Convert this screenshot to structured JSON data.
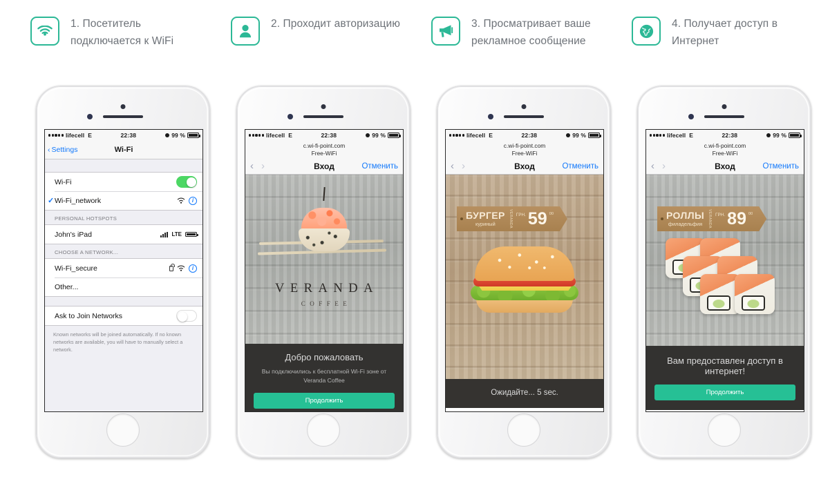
{
  "steps": [
    {
      "icon": "wifi-icon",
      "text": "1. Посетитель подключается к WiFi"
    },
    {
      "icon": "user-icon",
      "text": "2. Проходит авторизацию"
    },
    {
      "icon": "megaphone-icon",
      "text": "3. Просматривает ваше рекламное сообщение"
    },
    {
      "icon": "globe-icon",
      "text": "4. Получает доступ в Интернет"
    }
  ],
  "status_bar": {
    "carrier": "lifecell",
    "network": "E",
    "time": "22:38",
    "battery": "99 %"
  },
  "phone1": {
    "nav": {
      "back": "Settings",
      "title": "Wi-Fi"
    },
    "rows": {
      "wifi_label": "Wi-Fi",
      "wifi_toggle": "on",
      "connected_network": "Wi-Fi_network",
      "hotspots_header": "PERSONAL HOTSPOTS",
      "hotspot_name": "John's iPad",
      "hotspot_badge": "LTE",
      "choose_header": "CHOOSE A NETWORK...",
      "secure_network": "Wi-Fi_secure",
      "other": "Other...",
      "ask_label": "Ask to Join Networks",
      "ask_toggle": "off",
      "footnote": "Known networks will be joined automatically. If no known networks are available, you will have to manually select a network."
    }
  },
  "browser": {
    "url_line1": "c.wi-fi-point.com",
    "url_line2": "Free-WiFi",
    "title": "Вход",
    "cancel": "Отменить"
  },
  "phone2": {
    "brand_name": "VERANDA",
    "brand_sub": "COFFEE",
    "welcome_title": "Добро пожаловать",
    "welcome_sub": "Вы подключились к бесплатной Wi-Fi зоне от Veranda Coffee",
    "button": "Продолжить"
  },
  "phone3": {
    "tag_name": "БУРГЕР",
    "tag_sub": "куриный",
    "tag_vertical": "VERANDA",
    "currency": "ГРН.",
    "price": "59",
    "kopecks": "00",
    "wait_text": "Ожидайте... 5 sec."
  },
  "phone4": {
    "tag_name": "РОЛЛЫ",
    "tag_sub": "филадельфия",
    "tag_vertical": "VERANDA",
    "currency": "ГРН.",
    "price": "89",
    "kopecks": "00",
    "granted_title": "Вам предоставлен доступ в интернет!",
    "button": "Продолжить"
  },
  "colors": {
    "accent_green": "#26c095",
    "icon_border": "#2cb896",
    "ios_blue": "#1379fb",
    "toggle_on": "#4cd764",
    "dark_panel": "#333230",
    "tag_brown": "#b79061"
  }
}
